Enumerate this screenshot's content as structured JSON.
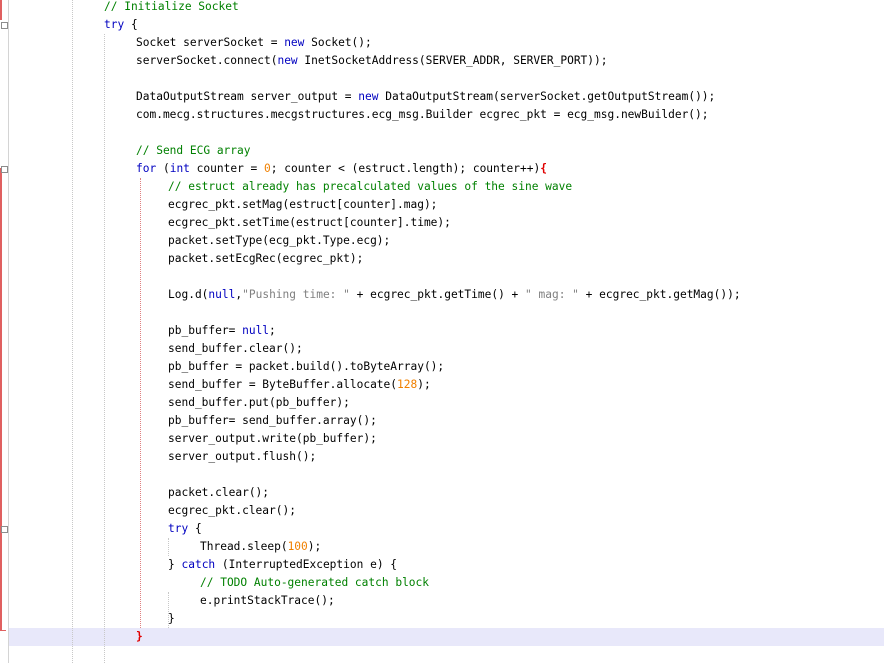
{
  "editor": {
    "lines": [
      {
        "indent": 104,
        "tokens": [
          {
            "t": "c",
            "v": "// Initialize Socket"
          }
        ]
      },
      {
        "indent": 104,
        "tokens": [
          {
            "t": "k",
            "v": "try"
          },
          {
            "t": "p",
            "v": " {"
          }
        ]
      },
      {
        "indent": 136,
        "tokens": [
          {
            "t": "p",
            "v": "Socket serverSocket = "
          },
          {
            "t": "k",
            "v": "new"
          },
          {
            "t": "p",
            "v": " Socket();"
          }
        ]
      },
      {
        "indent": 136,
        "tokens": [
          {
            "t": "p",
            "v": "serverSocket.connect("
          },
          {
            "t": "k",
            "v": "new"
          },
          {
            "t": "p",
            "v": " InetSocketAddress(SERVER_ADDR, SERVER_PORT));"
          }
        ]
      },
      {
        "indent": 136,
        "tokens": []
      },
      {
        "indent": 136,
        "tokens": [
          {
            "t": "p",
            "v": "DataOutputStream server_output = "
          },
          {
            "t": "k",
            "v": "new"
          },
          {
            "t": "p",
            "v": " DataOutputStream(serverSocket.getOutputStream());"
          }
        ]
      },
      {
        "indent": 136,
        "tokens": [
          {
            "t": "p",
            "v": "com.mecg.structures.mecgstructures.ecg_msg.Builder ecgrec_pkt = ecg_msg.newBuilder();"
          }
        ]
      },
      {
        "indent": 136,
        "tokens": []
      },
      {
        "indent": 136,
        "tokens": [
          {
            "t": "c",
            "v": "// Send ECG array"
          }
        ]
      },
      {
        "indent": 136,
        "tokens": [
          {
            "t": "k",
            "v": "for"
          },
          {
            "t": "p",
            "v": " ("
          },
          {
            "t": "k",
            "v": "int"
          },
          {
            "t": "p",
            "v": " counter = "
          },
          {
            "t": "n",
            "v": "0"
          },
          {
            "t": "p",
            "v": "; counter < (estruct.length); counter++)"
          },
          {
            "t": "b",
            "v": "{"
          }
        ]
      },
      {
        "indent": 168,
        "tokens": [
          {
            "t": "c",
            "v": "// estruct already has precalculated values of the sine wave"
          }
        ]
      },
      {
        "indent": 168,
        "tokens": [
          {
            "t": "p",
            "v": "ecgrec_pkt.setMag(estruct[counter].mag);"
          }
        ]
      },
      {
        "indent": 168,
        "tokens": [
          {
            "t": "p",
            "v": "ecgrec_pkt.setTime(estruct[counter].time);"
          }
        ]
      },
      {
        "indent": 168,
        "tokens": [
          {
            "t": "p",
            "v": "packet.setType(ecg_pkt.Type.ecg);"
          }
        ]
      },
      {
        "indent": 168,
        "tokens": [
          {
            "t": "p",
            "v": "packet.setEcgRec(ecgrec_pkt);"
          }
        ]
      },
      {
        "indent": 168,
        "tokens": []
      },
      {
        "indent": 168,
        "tokens": [
          {
            "t": "p",
            "v": "Log.d("
          },
          {
            "t": "k",
            "v": "null"
          },
          {
            "t": "p",
            "v": ","
          },
          {
            "t": "s",
            "v": "\"Pushing time: \""
          },
          {
            "t": "p",
            "v": " + ecgrec_pkt.getTime() + "
          },
          {
            "t": "s",
            "v": "\" mag: \""
          },
          {
            "t": "p",
            "v": " + ecgrec_pkt.getMag());"
          }
        ]
      },
      {
        "indent": 168,
        "tokens": []
      },
      {
        "indent": 168,
        "tokens": [
          {
            "t": "p",
            "v": "pb_buffer= "
          },
          {
            "t": "k",
            "v": "null"
          },
          {
            "t": "p",
            "v": ";"
          }
        ]
      },
      {
        "indent": 168,
        "tokens": [
          {
            "t": "p",
            "v": "send_buffer.clear();"
          }
        ]
      },
      {
        "indent": 168,
        "tokens": [
          {
            "t": "p",
            "v": "pb_buffer = packet.build().toByteArray();"
          }
        ]
      },
      {
        "indent": 168,
        "tokens": [
          {
            "t": "p",
            "v": "send_buffer = ByteBuffer.allocate("
          },
          {
            "t": "n",
            "v": "128"
          },
          {
            "t": "p",
            "v": ");"
          }
        ]
      },
      {
        "indent": 168,
        "tokens": [
          {
            "t": "p",
            "v": "send_buffer.put(pb_buffer);"
          }
        ]
      },
      {
        "indent": 168,
        "tokens": [
          {
            "t": "p",
            "v": "pb_buffer= send_buffer.array();"
          }
        ]
      },
      {
        "indent": 168,
        "tokens": [
          {
            "t": "p",
            "v": "server_output.write(pb_buffer);"
          }
        ]
      },
      {
        "indent": 168,
        "tokens": [
          {
            "t": "p",
            "v": "server_output.flush();"
          }
        ]
      },
      {
        "indent": 168,
        "tokens": []
      },
      {
        "indent": 168,
        "tokens": [
          {
            "t": "p",
            "v": "packet.clear();"
          }
        ]
      },
      {
        "indent": 168,
        "tokens": [
          {
            "t": "p",
            "v": "ecgrec_pkt.clear();"
          }
        ]
      },
      {
        "indent": 168,
        "tokens": [
          {
            "t": "k",
            "v": "try"
          },
          {
            "t": "p",
            "v": " {"
          }
        ]
      },
      {
        "indent": 200,
        "tokens": [
          {
            "t": "p",
            "v": "Thread.sleep("
          },
          {
            "t": "n",
            "v": "100"
          },
          {
            "t": "p",
            "v": ");"
          }
        ]
      },
      {
        "indent": 168,
        "tokens": [
          {
            "t": "p",
            "v": "} "
          },
          {
            "t": "k",
            "v": "catch"
          },
          {
            "t": "p",
            "v": " (InterruptedException e) {"
          }
        ]
      },
      {
        "indent": 200,
        "tokens": [
          {
            "t": "c",
            "v": "// TODO Auto-generated catch block"
          }
        ]
      },
      {
        "indent": 200,
        "tokens": [
          {
            "t": "p",
            "v": "e.printStackTrace();"
          }
        ]
      },
      {
        "indent": 168,
        "tokens": [
          {
            "t": "p",
            "v": "}"
          }
        ]
      },
      {
        "indent": 136,
        "tokens": [
          {
            "t": "b",
            "v": "}"
          }
        ]
      }
    ],
    "highlighted_line": 35,
    "colors": {
      "keyword": "#0000c0",
      "comment": "#008000",
      "string": "#808080",
      "number": "#f08000",
      "bracket_match": "#e00000",
      "current_line": "#e8e8fa"
    }
  }
}
